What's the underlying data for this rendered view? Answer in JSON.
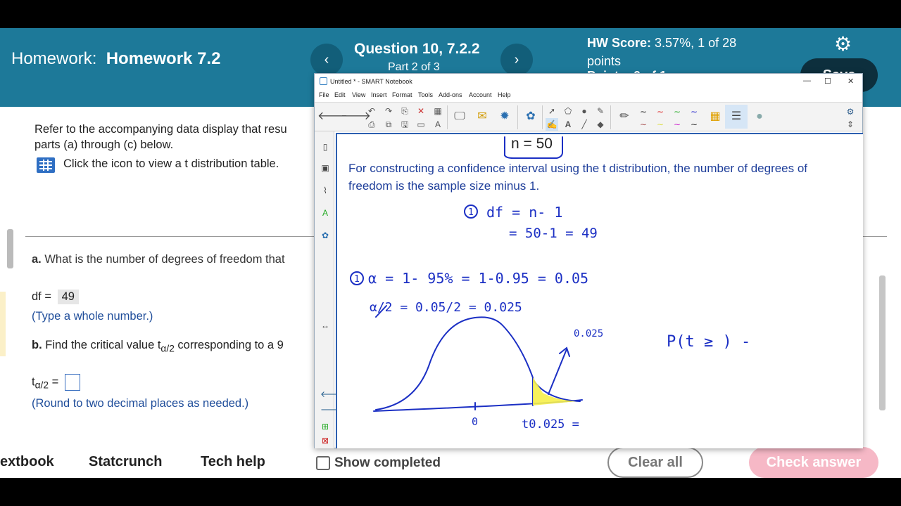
{
  "header": {
    "homework_label": "Homework:",
    "homework_name": "Homework 7.2",
    "question_title": "Question 10, 7.2.2",
    "question_part": "Part 2 of 3",
    "prev_icon": "chevron-left-icon",
    "next_icon": "chevron-right-icon",
    "hw_score_label": "HW Score:",
    "hw_score_value": "3.57%, 1 of 28",
    "hw_score_unit": "points",
    "points_partial": "Points: 0 of 1",
    "save_label": "Save",
    "settings_icon": "gear-icon",
    "colors": {
      "header_bg": "#1d7999",
      "nav_bg": "#125e79",
      "save_bg": "#0d2f3d"
    }
  },
  "question": {
    "intro_line1": "Refer to the accompanying data display that resu",
    "intro_line2": "parts (a) through (c) below.",
    "table_link": "Click the icon to view a t distribution table.",
    "part_a_label": "a.",
    "part_a_text": "What is the number of degrees of freedom that",
    "df_label": "df =",
    "df_value": "49",
    "df_hint": "(Type a whole number.)",
    "part_b_label": "b.",
    "part_b_text": "Find the critical value t",
    "part_b_sub": "α/2",
    "part_b_rest": " corresponding to a 9",
    "t_label": "t",
    "t_sub": "α/2",
    "t_eq": " =",
    "t_hint": "(Round to two decimal places as needed.)"
  },
  "footer": {
    "textbook": "extbook",
    "statcrunch": "Statcrunch",
    "tech_help": "Tech help",
    "show_completed": "Show completed",
    "clear_all": "Clear all",
    "check_answer": "Check answer"
  },
  "notebook": {
    "window_title": "Untitled * - SMART Notebook",
    "menu": [
      "File",
      "Edit",
      "View",
      "Insert",
      "Format",
      "Tools",
      "Add-ons",
      "Account",
      "Help"
    ],
    "typed_text": "For constructing a confidence interval using the t distribution, the number of degrees of freedom is the sample size minus 1.",
    "ink": {
      "n_box": "n = 50",
      "step1_mark": "1",
      "df_line1": "df = n- 1",
      "df_line2": "= 50-1  = 49",
      "step2_mark": "1",
      "alpha_line": "α = 1- 95% = 1-0.95  =  0.05",
      "half_alpha": "α/2 =  0.05/2  =  0.025",
      "tail_value": "0.025",
      "zero_label": "0",
      "t_label": "t0.025 =",
      "prob_expr": "P(t ≥   ) -"
    },
    "ink_color": "#1b2fc4",
    "shade_color": "#f6f04a"
  }
}
